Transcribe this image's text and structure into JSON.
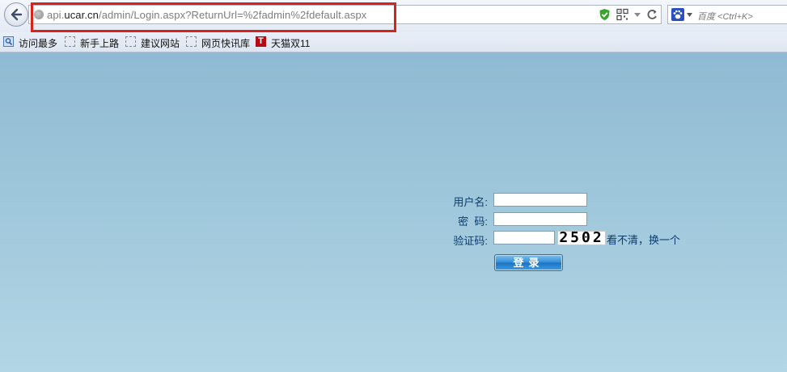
{
  "browser": {
    "url": {
      "domain_prefix": "api.",
      "domain_main": "ucar.cn",
      "path": "/admin/Login.aspx?ReturnUrl=%2fadmin%2fdefault.aspx"
    },
    "search_placeholder": "百度 <Ctrl+K>",
    "bookmarks": [
      {
        "label": "访问最多",
        "icon": "search-icon"
      },
      {
        "label": "新手上路",
        "icon": "bookmark-icon"
      },
      {
        "label": "建议网站",
        "icon": "bookmark-icon"
      },
      {
        "label": "网页快讯库",
        "icon": "bookmark-icon"
      },
      {
        "label": "天猫双11",
        "icon": "tmall-icon",
        "icon_text": "T"
      }
    ],
    "colors": {
      "highlight": "#d9221c",
      "shield": "#3aa42f"
    }
  },
  "login": {
    "username_label": "用户名:",
    "password_label": "密  码:",
    "captcha_label": "验证码:",
    "username_value": "",
    "password_value": "",
    "captcha_value": "",
    "captcha_image_text": "2502",
    "refresh_link": "看不清，换一个",
    "submit_label": "登录"
  },
  "colors": {
    "page_bg": "#8fbad3",
    "label_text": "#0d3b6c",
    "button": "#2f8dd6"
  }
}
